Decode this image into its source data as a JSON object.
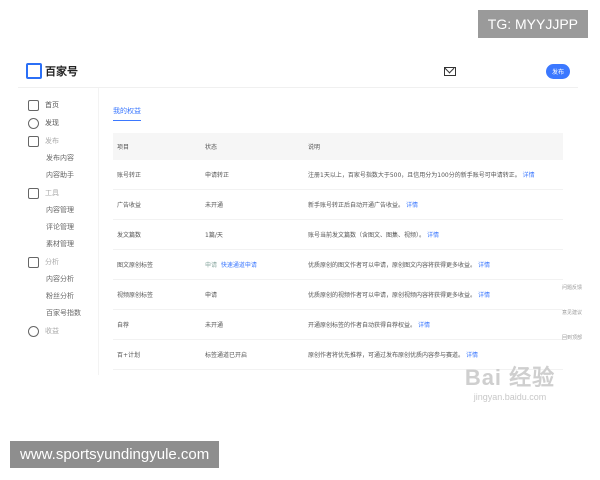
{
  "watermarks": {
    "tg": "TG: MYYJJPP",
    "url": "www.sportsyundingyule.com",
    "baidu_big": "Bai 经验",
    "baidu_small": "jingyan.baidu.com"
  },
  "header": {
    "logo": "百家号",
    "publish_button": "发布"
  },
  "sidebar": {
    "items": [
      {
        "label": "首页"
      },
      {
        "label": "发现"
      },
      {
        "label": "发布"
      },
      {
        "label": "工具"
      },
      {
        "label": "分析"
      },
      {
        "label": "收益"
      }
    ],
    "sub_publish": [
      "发布内容",
      "内容助手"
    ],
    "sub_tools": [
      "内容管理",
      "评论管理",
      "素材管理"
    ],
    "sub_analysis": [
      "内容分析",
      "粉丝分析",
      "百家号指数"
    ]
  },
  "main": {
    "tab": "我的权益",
    "table": {
      "headers": [
        "项目",
        "状态",
        "说明"
      ],
      "rows": [
        {
          "item": "账号转正",
          "status": "申请转正",
          "desc": "注册1天以上，百家号指数大于500，且信用分为100分的新手账号可申请转正。",
          "link": "详情"
        },
        {
          "item": "广告收益",
          "status": "未开通",
          "desc": "新手账号转正后自动开通广告收益。",
          "link": "详情"
        },
        {
          "item": "发文篇数",
          "status": "1篇/天",
          "desc": "账号当前发文篇数（含图文、图集、视频）。",
          "link": "详情"
        },
        {
          "item": "图文原创标签",
          "status": "申请",
          "status2": "快速通道申请",
          "desc": "优质原创的图文作者可以申请，原创图文内容将获得更多收益。",
          "link": "详情"
        },
        {
          "item": "视频原创标签",
          "status": "申请",
          "desc": "优质原创的视频作者可以申请，原创视频内容将获得更多收益。",
          "link": "详情"
        },
        {
          "item": "自荐",
          "status": "未开通",
          "desc": "开通原创标签的作者自动获得自荐权益。",
          "link": "详情"
        },
        {
          "item": "百+计划",
          "status": "标签通道已开启",
          "desc": "原创作者将优先推荐，可通过发布原创优质内容参与赛道。",
          "link": "详情"
        }
      ]
    }
  },
  "floating": [
    "问题反馈",
    "意见建议",
    "回到顶部"
  ]
}
